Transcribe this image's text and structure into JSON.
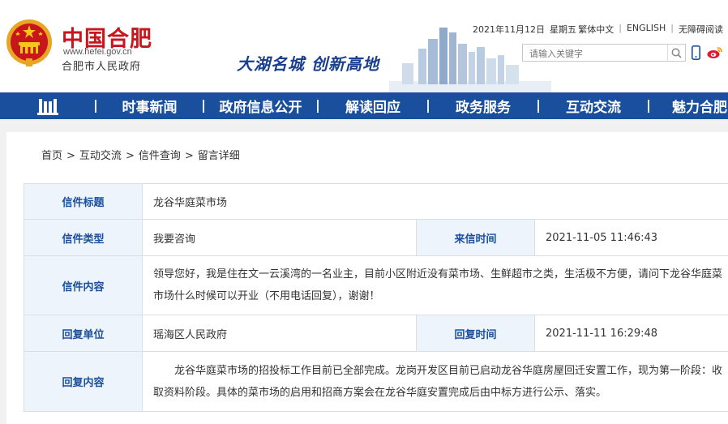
{
  "header": {
    "site_name": "中国合肥",
    "site_url": "www.hefei.gov.cn",
    "site_sub": "合肥市人民政府",
    "slogan": "大湖名城  创新高地",
    "date": "2021年11月12日",
    "weekday": "星期五",
    "links": [
      "繁体中文",
      "ENGLISH",
      "无障碍阅读"
    ],
    "search_placeholder": "请输入关键字",
    "icons": [
      "search-icon",
      "phone-icon",
      "weibo-icon"
    ]
  },
  "nav": {
    "items": [
      "时事新闻",
      "政府信息公开",
      "解读回应",
      "政务服务",
      "互动交流",
      "魅力合肥"
    ]
  },
  "breadcrumb": [
    "首页",
    "互动交流",
    "信件查询",
    "留言详细"
  ],
  "letter": {
    "title_label": "信件标题",
    "title": "龙谷华庭菜市场",
    "type_label": "信件类型",
    "type": "我要咨询",
    "time_label": "来信时间",
    "time": "2021-11-05 11:46:43",
    "content_label": "信件内容",
    "content": "领导您好，我是住在文一云溪湾的一名业主，目前小区附近没有菜市场、生鲜超市之类，生活极不方便，请问下龙谷华庭菜市场什么时候可以开业（不用电话回复），谢谢！",
    "reply_unit_label": "回复单位",
    "reply_unit": "瑶海区人民政府",
    "reply_time_label": "回复时间",
    "reply_time": "2021-11-11 16:29:48",
    "reply_content_label": "回复内容",
    "reply_content": "龙谷华庭菜市场的招投标工作目前已全部完成。龙岗开发区目前已启动龙谷华庭房屋回迁安置工作，现为第一阶段：收取资料阶段。具体的菜市场的启用和招商方案会在龙谷华庭安置完成后由中标方进行公示、落实。"
  },
  "colors": {
    "nav_bg": "#1a4f9e",
    "label_bg": "#eef4fc",
    "label_text": "#1a4f9e",
    "brand_red": "#c8161d"
  }
}
